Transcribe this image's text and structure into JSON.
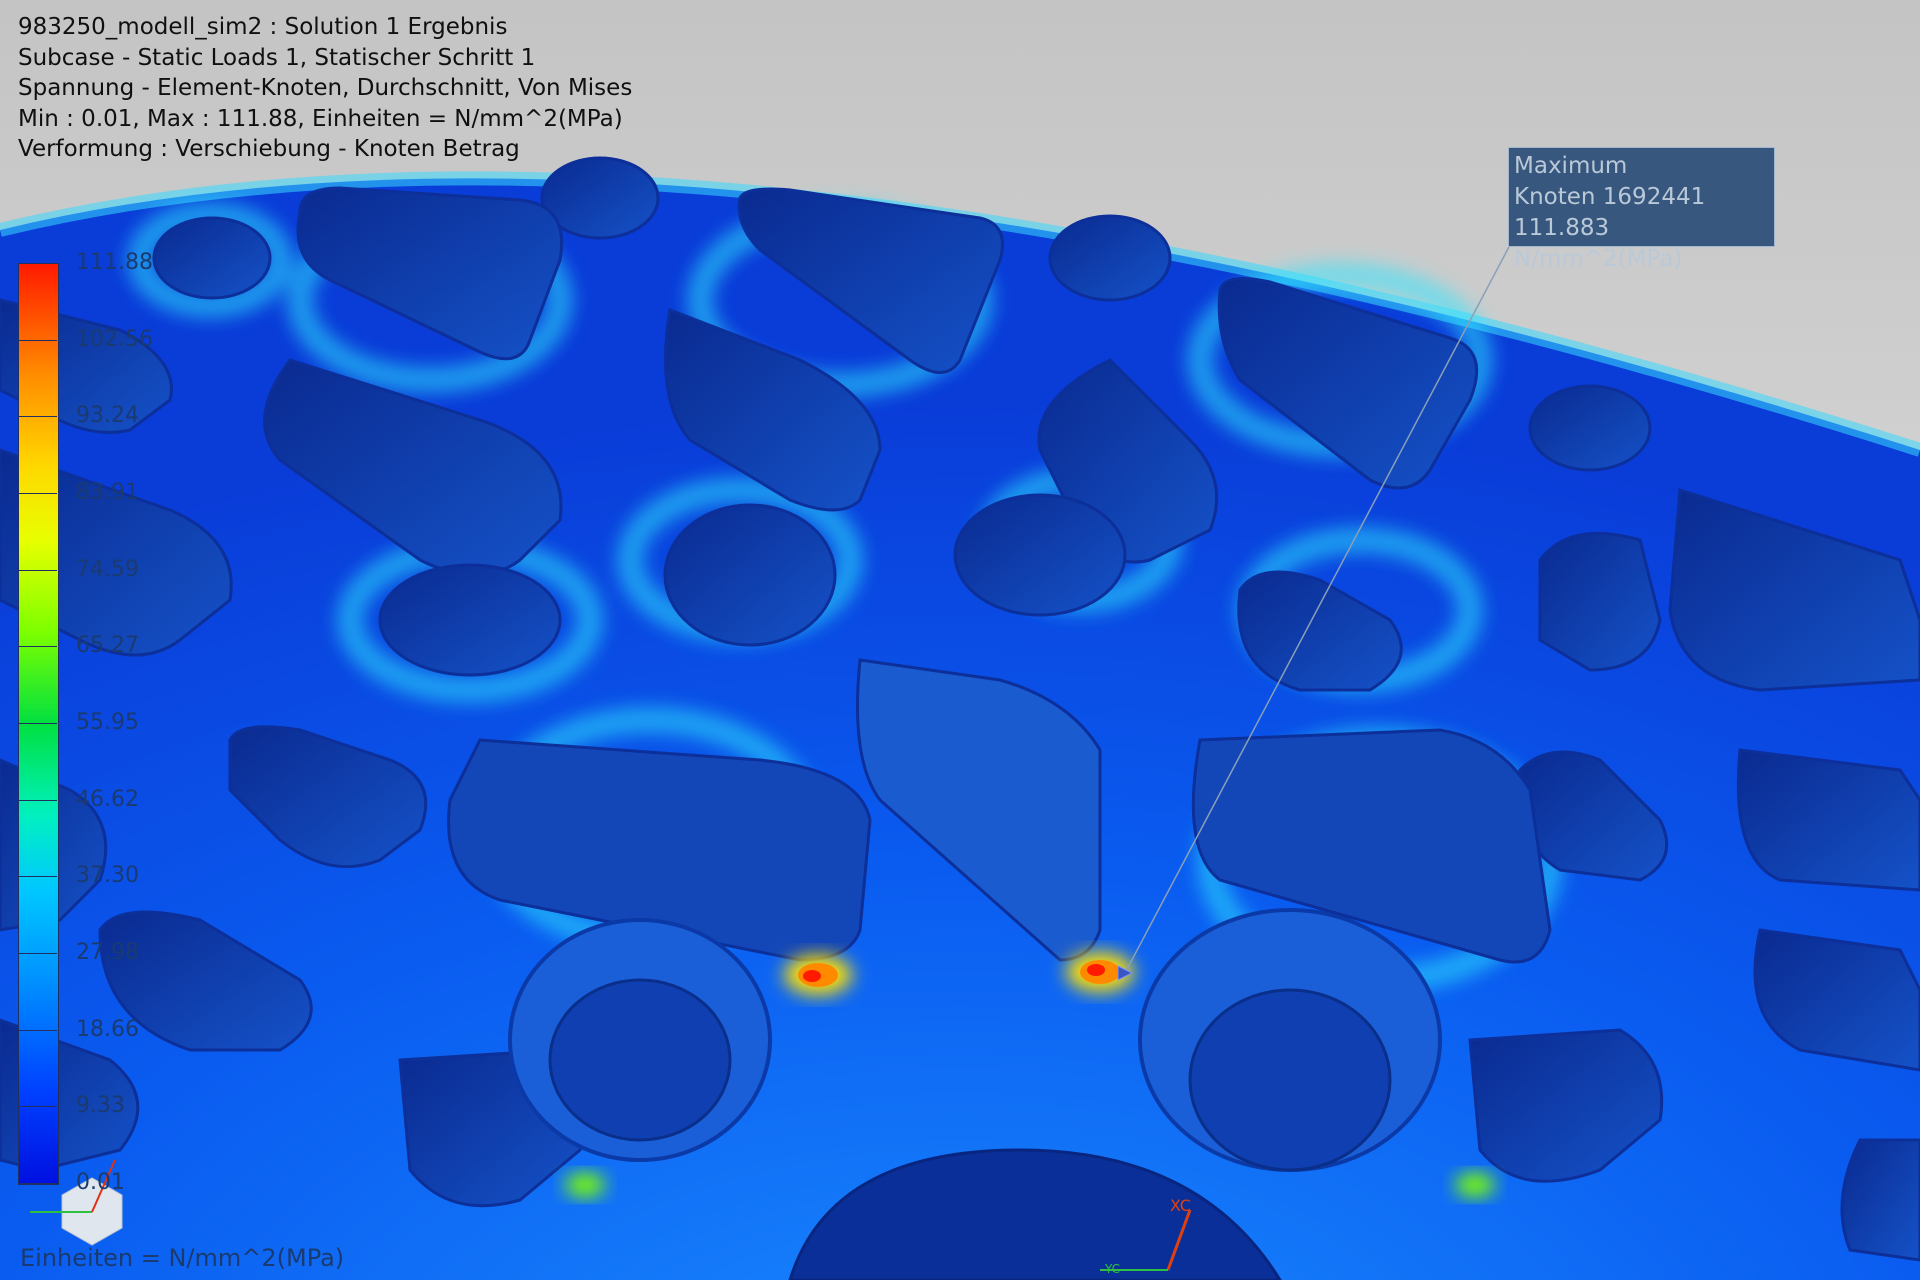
{
  "header": {
    "line1": "983250_modell_sim2 : Solution 1 Ergebnis",
    "line2": "Subcase - Static Loads 1, Statischer Schritt 1",
    "line3": "Spannung - Element-Knoten, Durchschnitt, Von Mises",
    "line4": "Min : 0.01, Max : 111.88, Einheiten = N/mm^2(MPa)",
    "line5": "Verformung : Verschiebung - Knoten Betrag"
  },
  "legend": {
    "ticks": [
      "111.88",
      "102.56",
      "93.24",
      "83.91",
      "74.59",
      "65.27",
      "55.95",
      "46.62",
      "37.30",
      "27.98",
      "18.66",
      "9.33",
      "0.01"
    ],
    "units": "Einheiten = N/mm^2(MPa)"
  },
  "max_tooltip": {
    "title": "Maximum",
    "node": "Knoten 1692441",
    "value": "111.883 N/mm^2(MPa)"
  },
  "triad": {
    "x_label": "XC",
    "y_label": "YC"
  },
  "colors": {
    "max": "#ff1a00",
    "min": "#0010e0",
    "background": "#d8d8d8",
    "tooltip_bg": "#2c4e78"
  }
}
